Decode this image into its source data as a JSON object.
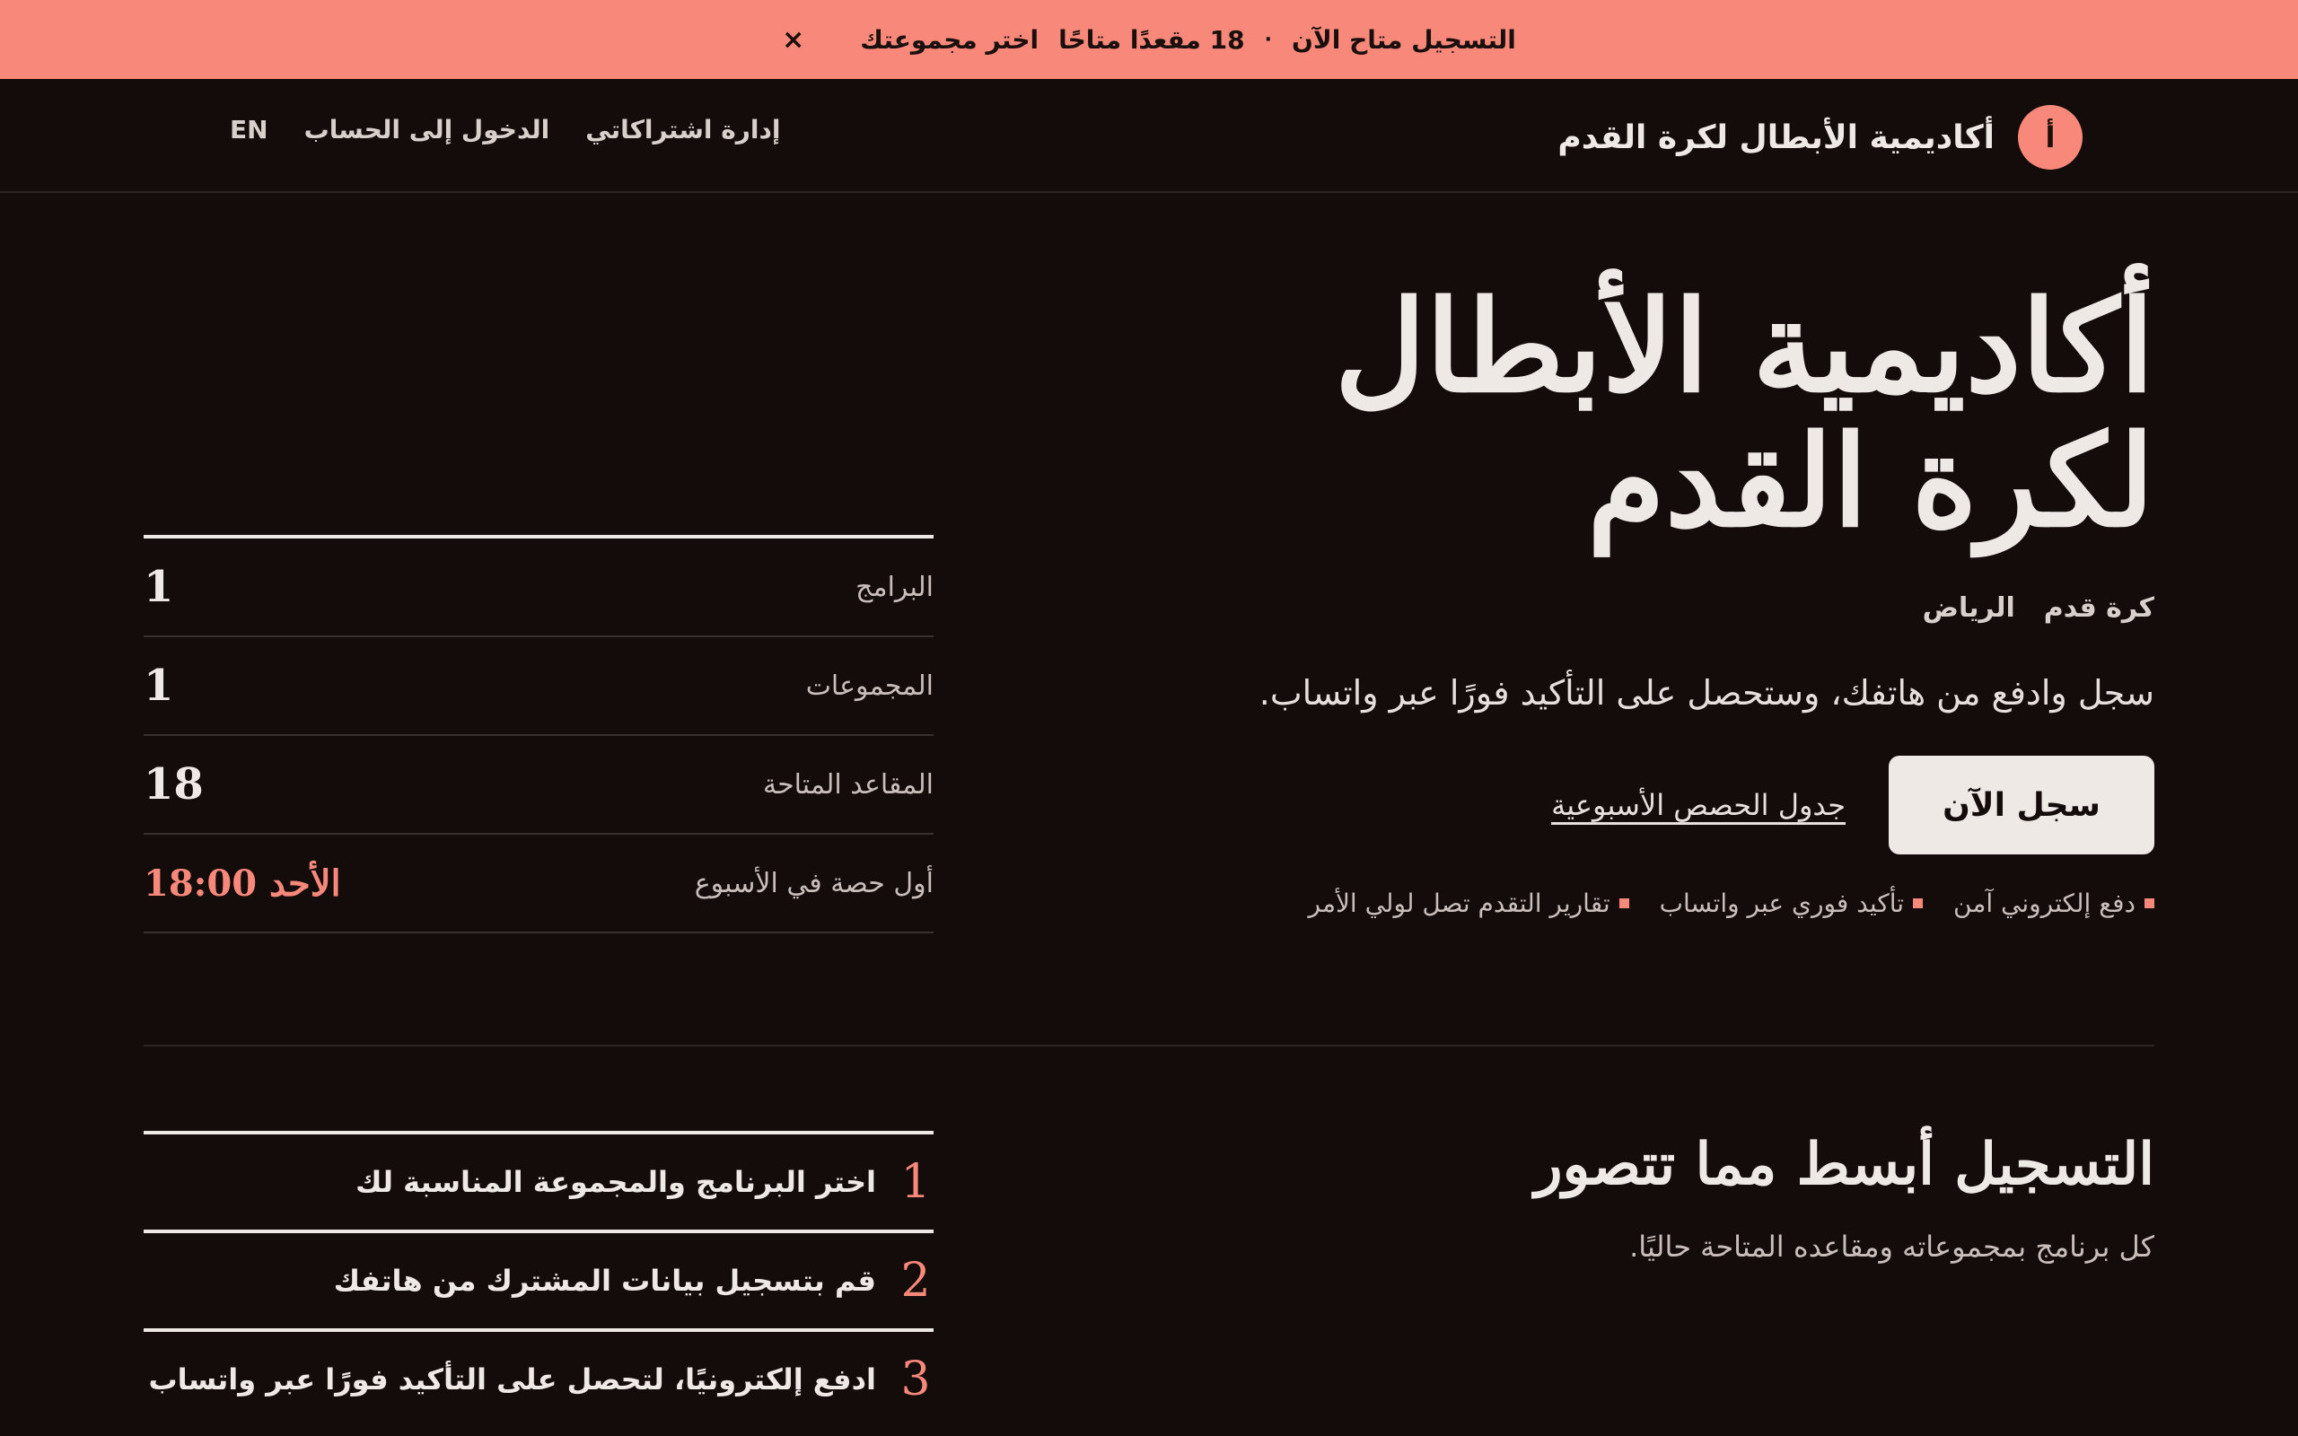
{
  "banner": {
    "message": "التسجيل متاح الآن",
    "separator": "·",
    "seats": "18 مقعدًا متاحًا",
    "cta": "اختر مجموعتك",
    "close": "×"
  },
  "header": {
    "brand_mark": "أ",
    "brand_name": "أكاديمية الأبطال لكرة القدم",
    "nav": {
      "manage": "إدارة اشتراكاتي",
      "login": "الدخول إلى الحساب",
      "language": "EN"
    }
  },
  "hero": {
    "title_line1": "أكاديمية الأبطال",
    "title_line2": "لكرة القدم",
    "tags": [
      "كرة قدم",
      "الرياض"
    ],
    "lead": "سجل وادفع من هاتفك، وستحصل على التأكيد فورًا عبر واتساب.",
    "primary_button": "سجل الآن",
    "secondary_link": "جدول الحصص الأسبوعية",
    "features": [
      "دفع إلكتروني آمن",
      "تأكيد فوري عبر واتساب",
      "تقارير التقدم تصل لولي الأمر"
    ]
  },
  "stats": [
    {
      "label": "البرامج",
      "value": "1"
    },
    {
      "label": "المجموعات",
      "value": "1"
    },
    {
      "label": "المقاعد المتاحة",
      "value": "18"
    },
    {
      "label": "أول حصة في الأسبوع",
      "value": "الأحد 18:00"
    }
  ],
  "section": {
    "title": "التسجيل أبسط مما تتصور",
    "subtitle": "كل برنامج بمجموعاته ومقاعده المتاحة حاليًا.",
    "steps": [
      {
        "num": "1",
        "text": "اختر البرنامج والمجموعة المناسبة لك"
      },
      {
        "num": "2",
        "text": "قم بتسجيل بيانات المشترك من هاتفك"
      },
      {
        "num": "3",
        "text": "ادفع إلكترونيًا، لتحصل على التأكيد فورًا عبر واتساب"
      }
    ]
  },
  "colors": {
    "background": "#140c0b",
    "accent": "#f8897a",
    "text": "#efe9e6"
  }
}
